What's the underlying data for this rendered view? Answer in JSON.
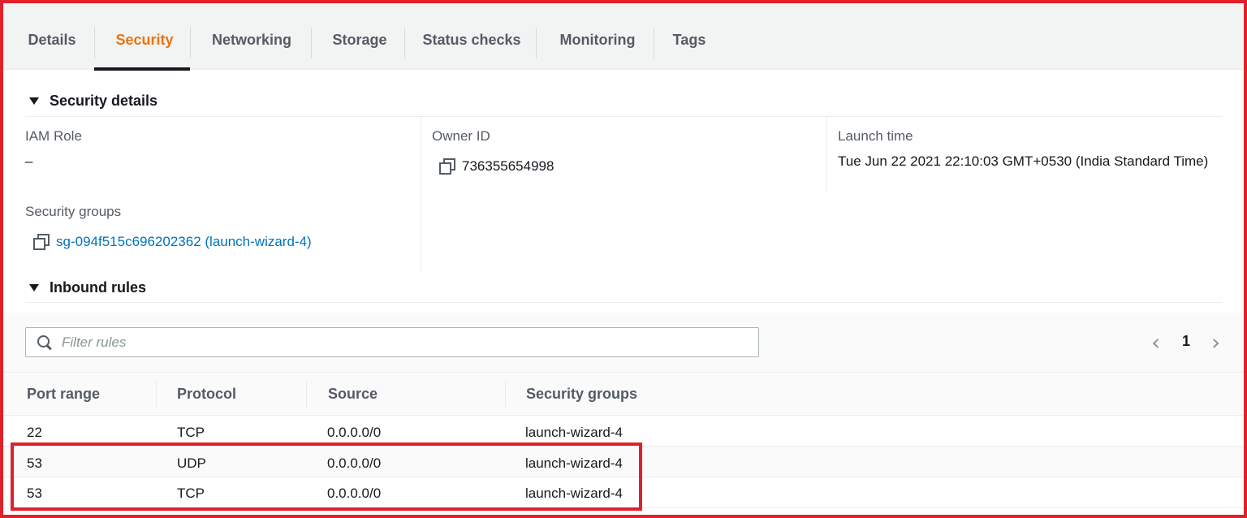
{
  "tabs": [
    {
      "label": "Details"
    },
    {
      "label": "Security"
    },
    {
      "label": "Networking"
    },
    {
      "label": "Storage"
    },
    {
      "label": "Status checks"
    },
    {
      "label": "Monitoring"
    },
    {
      "label": "Tags"
    }
  ],
  "active_tab": "Security",
  "security_details": {
    "heading": "Security details",
    "iam_role": {
      "label": "IAM Role",
      "value": "–"
    },
    "owner_id": {
      "label": "Owner ID",
      "value": "736355654998"
    },
    "launch_time": {
      "label": "Launch time",
      "value": "Tue Jun 22 2021 22:10:03 GMT+0530 (India Standard Time)"
    },
    "security_groups": {
      "label": "Security groups",
      "value": "sg-094f515c696202362 (launch-wizard-4)"
    }
  },
  "inbound_rules": {
    "heading": "Inbound rules",
    "filter_placeholder": "Filter rules",
    "page": "1",
    "columns": [
      "Port range",
      "Protocol",
      "Source",
      "Security groups"
    ],
    "rows": [
      [
        "22",
        "TCP",
        "0.0.0.0/0",
        "launch-wizard-4"
      ],
      [
        "53",
        "UDP",
        "0.0.0.0/0",
        "launch-wizard-4"
      ],
      [
        "53",
        "TCP",
        "0.0.0.0/0",
        "launch-wizard-4"
      ]
    ]
  },
  "colors": {
    "accent_active_tab": "#ec7211",
    "link": "#0073bb",
    "highlight_border": "#e0202b"
  }
}
